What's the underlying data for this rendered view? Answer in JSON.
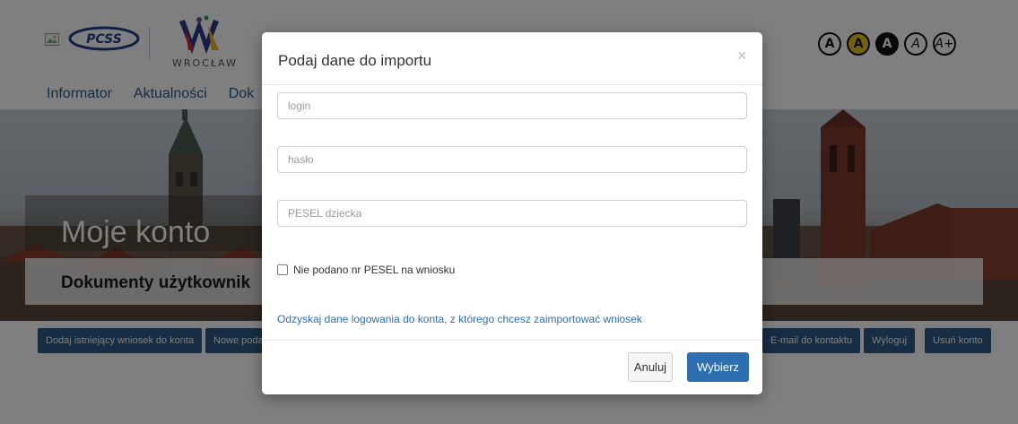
{
  "header": {
    "wroclaw_text": "WROCŁAW",
    "pcss_text": "PCSS",
    "accessibility": [
      "A",
      "A",
      "A",
      "A",
      "A+"
    ]
  },
  "nav": {
    "items": [
      "Informator",
      "Aktualności",
      "Dok"
    ]
  },
  "hero": {
    "title": "Moje konto",
    "subtitle": "Dokumenty użytkownik"
  },
  "actions": {
    "add_existing": "Dodaj istniejący wniosek do konta",
    "new_prefix": "Nowe podan",
    "email": "E-mail do kontaktu",
    "logout": "Wyloguj",
    "delete": "Usuń konto"
  },
  "modal": {
    "title": "Podaj dane do importu",
    "close": "×",
    "login_placeholder": "login",
    "password_placeholder": "hasło",
    "pesel_placeholder": "PESEL dziecka",
    "checkbox_label": "Nie podano nr PESEL na wniosku",
    "recover_link": "Odzyskaj dane logowania do konta, z którego chcesz zaimportować wniosek",
    "cancel": "Anuluj",
    "confirm": "Wybierz"
  },
  "colors": {
    "primary": "#2d6fb0",
    "dark_button": "#2d5a87",
    "accent_yellow": "#e8c517"
  }
}
